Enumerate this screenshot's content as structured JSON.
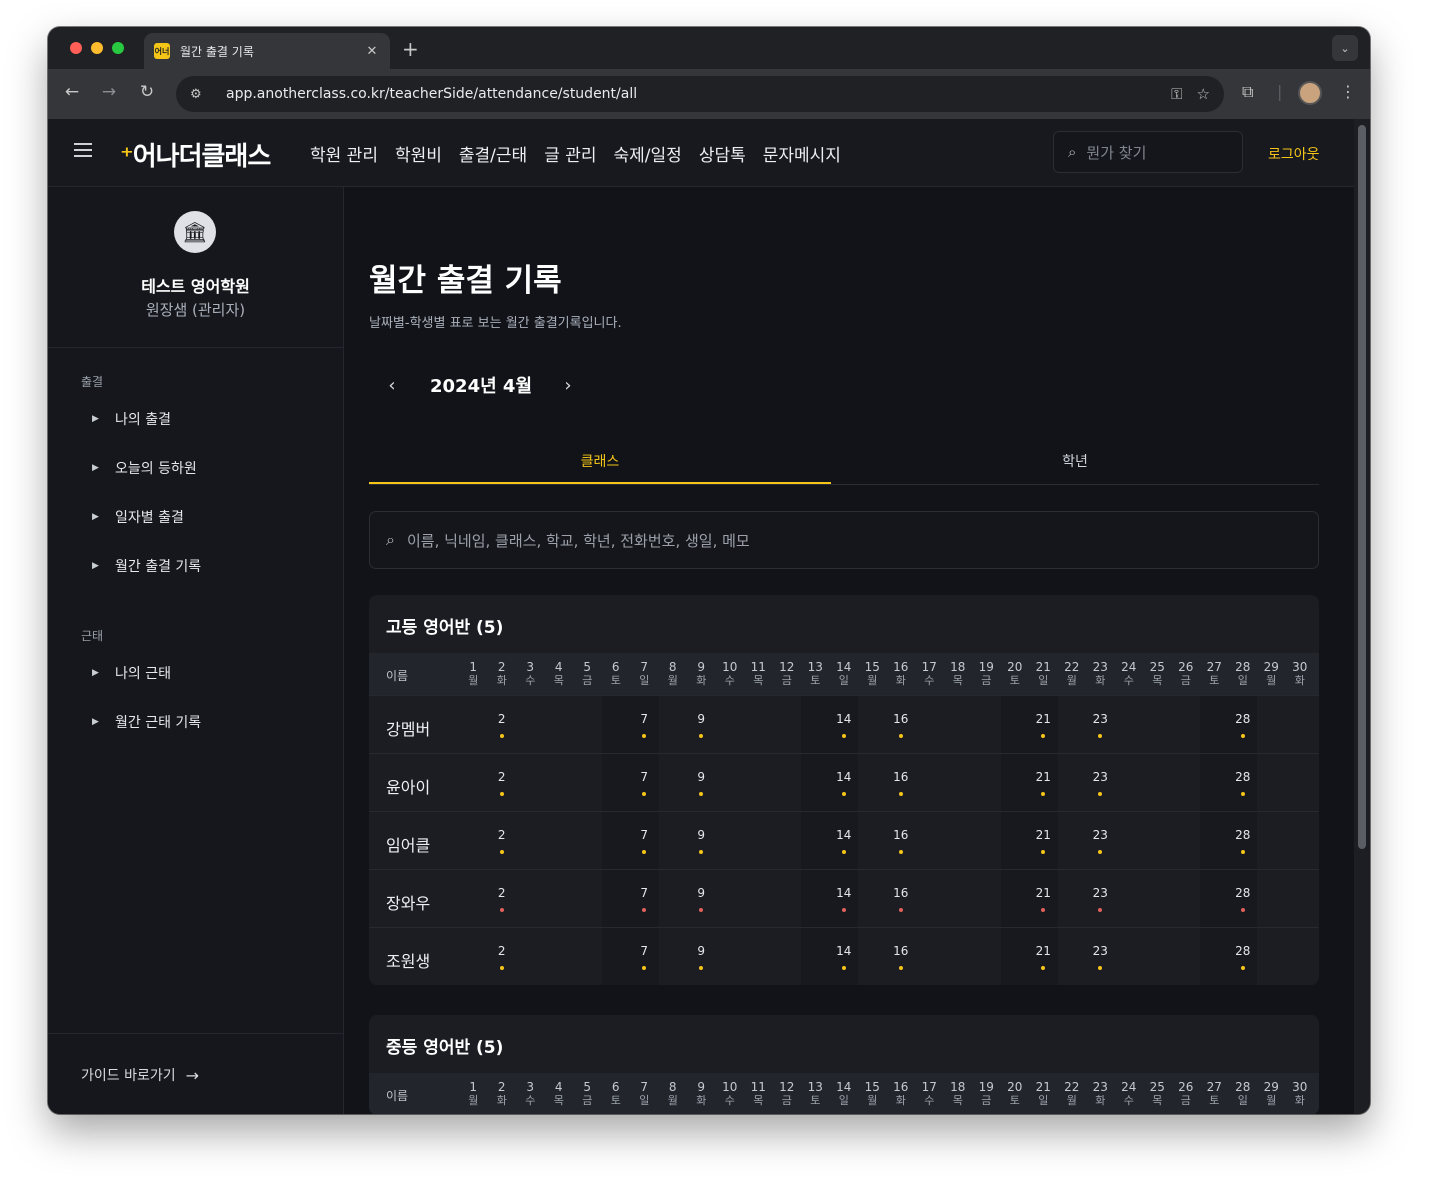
{
  "browser": {
    "tab_title": "월간 출결 기록",
    "tab_favicon_text": "어너",
    "url": "app.anotherclass.co.kr/teacherSide/attendance/student/all"
  },
  "header": {
    "logo_text": "어나더클래스",
    "nav": [
      "학원 관리",
      "학원비",
      "출결/근태",
      "글 관리",
      "숙제/일정",
      "상담톡",
      "문자메시지"
    ],
    "search_placeholder": "뭔가 찾기",
    "logout_label": "로그아웃"
  },
  "sidebar": {
    "org_name": "테스트 영어학원",
    "org_role": "원장샘 (관리자)",
    "sections": [
      {
        "title": "출결",
        "items": [
          "나의 출결",
          "오늘의 등하원",
          "일자별 출결",
          "월간 출결 기록"
        ]
      },
      {
        "title": "근태",
        "items": [
          "나의 근태",
          "월간 근태 기록"
        ]
      }
    ],
    "guide_label": "가이드 바로가기"
  },
  "main": {
    "title": "월간 출결 기록",
    "subtitle": "날짜별-학생별 표로 보는 월간 출결기록입니다.",
    "month_label": "2024년 4월",
    "tabs": [
      "클래스",
      "학년"
    ],
    "active_tab": "클래스",
    "student_search_placeholder": "이름, 닉네임, 클래스, 학교, 학년, 전화번호, 생일, 메모"
  },
  "calendar": {
    "name_header": "이름",
    "days": [
      1,
      2,
      3,
      4,
      5,
      6,
      7,
      8,
      9,
      10,
      11,
      12,
      13,
      14,
      15,
      16,
      17,
      18,
      19,
      20,
      21,
      22,
      23,
      24,
      25,
      26,
      27,
      28,
      29,
      30
    ],
    "weekdays": [
      "월",
      "화",
      "수",
      "목",
      "금",
      "토",
      "일",
      "월",
      "화",
      "수",
      "목",
      "금",
      "토",
      "일",
      "월",
      "화",
      "수",
      "목",
      "금",
      "토",
      "일",
      "월",
      "화",
      "수",
      "목",
      "금",
      "토",
      "일",
      "월",
      "화"
    ],
    "weekend_days": [
      6,
      7,
      13,
      14,
      20,
      21,
      27,
      28
    ]
  },
  "classes": [
    {
      "title": "고등 영어반 (5)",
      "students": [
        {
          "name": "강멤버",
          "status": "present",
          "days": [
            2,
            7,
            9,
            14,
            16,
            21,
            23,
            28
          ]
        },
        {
          "name": "윤아이",
          "status": "present",
          "days": [
            2,
            7,
            9,
            14,
            16,
            21,
            23,
            28
          ]
        },
        {
          "name": "임어클",
          "status": "present",
          "days": [
            2,
            7,
            9,
            14,
            16,
            21,
            23,
            28
          ]
        },
        {
          "name": "장와우",
          "status": "absent",
          "days": [
            2,
            7,
            9,
            14,
            16,
            21,
            23,
            28
          ]
        },
        {
          "name": "조원생",
          "status": "present",
          "days": [
            2,
            7,
            9,
            14,
            16,
            21,
            23,
            28
          ]
        }
      ]
    },
    {
      "title": "중등 영어반 (5)",
      "students": []
    }
  ],
  "colors": {
    "accent": "#f5c518",
    "present_dot": "#f5c518",
    "absent_dot": "#e0605c"
  }
}
